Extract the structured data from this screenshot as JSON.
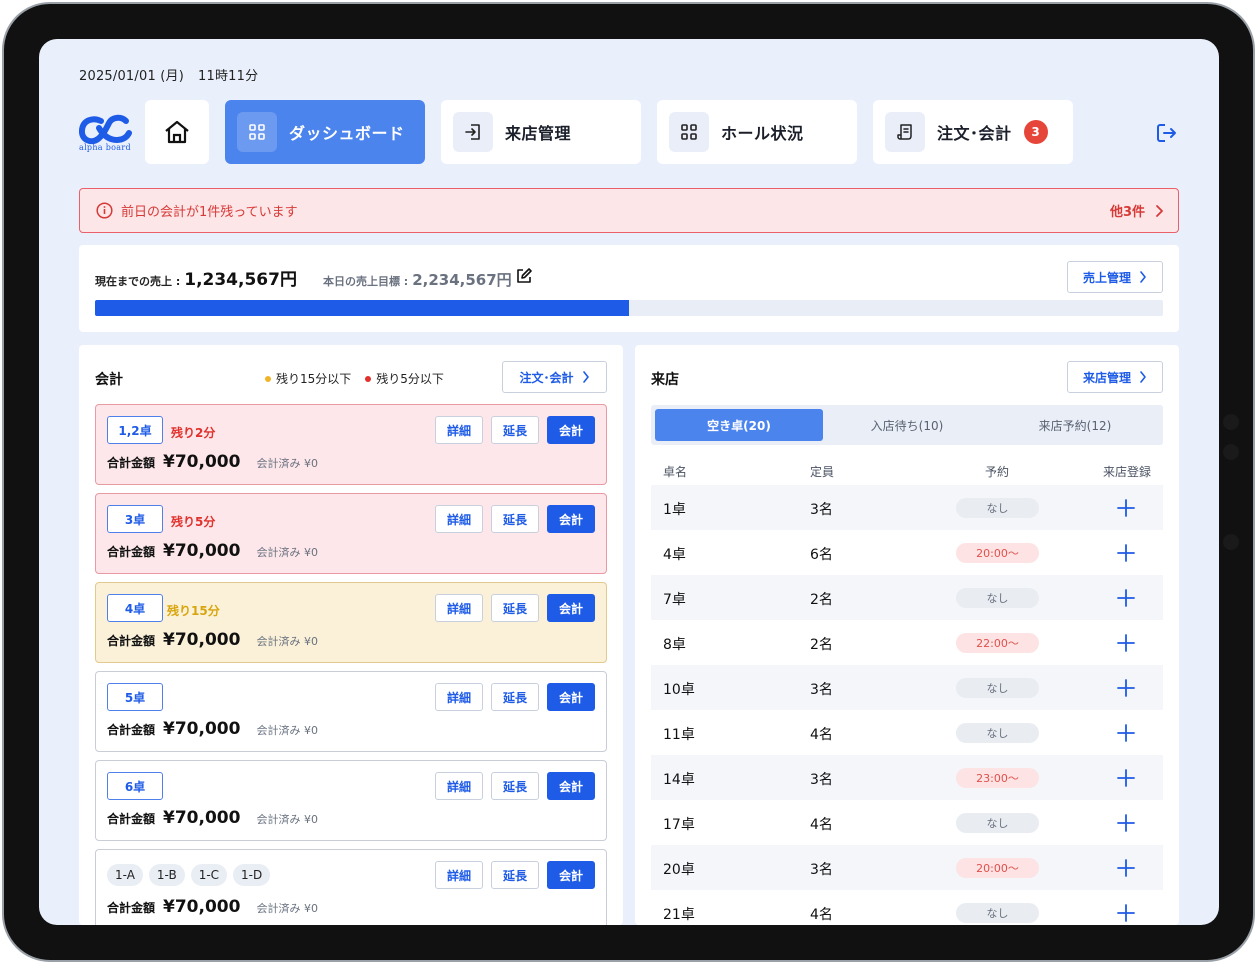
{
  "header": {
    "date": "2025/01/01 (月)",
    "time": "11時11分",
    "logo_text": "alpha board"
  },
  "nav": {
    "home_icon": "home-icon",
    "items": [
      {
        "label": "ダッシュボード",
        "icon": "grid-icon",
        "active": true
      },
      {
        "label": "来店管理",
        "icon": "enter-icon",
        "active": false
      },
      {
        "label": "ホール状況",
        "icon": "grid-icon",
        "active": false
      },
      {
        "label": "注文･会計",
        "icon": "receipt-icon",
        "active": false,
        "badge": "3"
      }
    ],
    "logout_icon": "logout-icon"
  },
  "alert": {
    "message": "前日の会計が1件残っています",
    "more": "他3件"
  },
  "sales": {
    "current_label": "現在までの売上 :",
    "current_value": "1,234,567円",
    "target_label": "本日の売上目標 :",
    "target_value": "2,234,567円",
    "manage_button": "売上管理",
    "progress": 0.5
  },
  "checkout": {
    "title": "会計",
    "legend": [
      {
        "label": "残り15分以下",
        "color": "#f0b429"
      },
      {
        "label": "残り5分以下",
        "color": "#e0312c"
      }
    ],
    "order_button": "注文･会計",
    "detail_label": "詳細",
    "extend_label": "延長",
    "pay_label": "会計",
    "total_label": "合計金額",
    "cards": [
      {
        "table": "1,2卓",
        "status": "red",
        "remain": "残り2分",
        "total": "¥70,000",
        "paid": "会計済み ¥0"
      },
      {
        "table": "3卓",
        "status": "red",
        "remain": "残り5分",
        "total": "¥70,000",
        "paid": "会計済み ¥0"
      },
      {
        "table": "4卓",
        "status": "yellow",
        "remain": "残り15分",
        "total": "¥70,000",
        "paid": "会計済み ¥0"
      },
      {
        "table": "5卓",
        "status": "normal",
        "remain": "",
        "total": "¥70,000",
        "paid": "会計済み ¥0"
      },
      {
        "table": "6卓",
        "status": "normal",
        "remain": "",
        "total": "¥70,000",
        "paid": "会計済み ¥0"
      },
      {
        "chips": [
          "1-A",
          "1-B",
          "1-C",
          "1-D"
        ],
        "status": "normal",
        "remain": "",
        "total": "¥70,000",
        "paid": "会計済み ¥0"
      }
    ]
  },
  "visit": {
    "title": "来店",
    "manage_button": "来店管理",
    "tabs": [
      {
        "label": "空き卓(20)",
        "active": true
      },
      {
        "label": "入店待ち(10)",
        "active": false
      },
      {
        "label": "来店予約(12)",
        "active": false
      }
    ],
    "columns": [
      "卓名",
      "定員",
      "予約",
      "来店登録"
    ],
    "rows": [
      {
        "table": "1卓",
        "capacity": "3名",
        "reservation": "なし",
        "reserved": false
      },
      {
        "table": "4卓",
        "capacity": "6名",
        "reservation": "20:00〜",
        "reserved": true
      },
      {
        "table": "7卓",
        "capacity": "2名",
        "reservation": "なし",
        "reserved": false
      },
      {
        "table": "8卓",
        "capacity": "2名",
        "reservation": "22:00〜",
        "reserved": true
      },
      {
        "table": "10卓",
        "capacity": "3名",
        "reservation": "なし",
        "reserved": false
      },
      {
        "table": "11卓",
        "capacity": "4名",
        "reservation": "なし",
        "reserved": false
      },
      {
        "table": "14卓",
        "capacity": "3名",
        "reservation": "23:00〜",
        "reserved": true
      },
      {
        "table": "17卓",
        "capacity": "4名",
        "reservation": "なし",
        "reserved": false
      },
      {
        "table": "20卓",
        "capacity": "3名",
        "reservation": "20:00〜",
        "reserved": true
      },
      {
        "table": "21卓",
        "capacity": "4名",
        "reservation": "なし",
        "reserved": false
      }
    ]
  },
  "colors": {
    "accent": "#1e5be6",
    "nav_active": "#4c84ee",
    "alert_red": "#d63a37",
    "screen_bg": "#eaf0fb"
  }
}
